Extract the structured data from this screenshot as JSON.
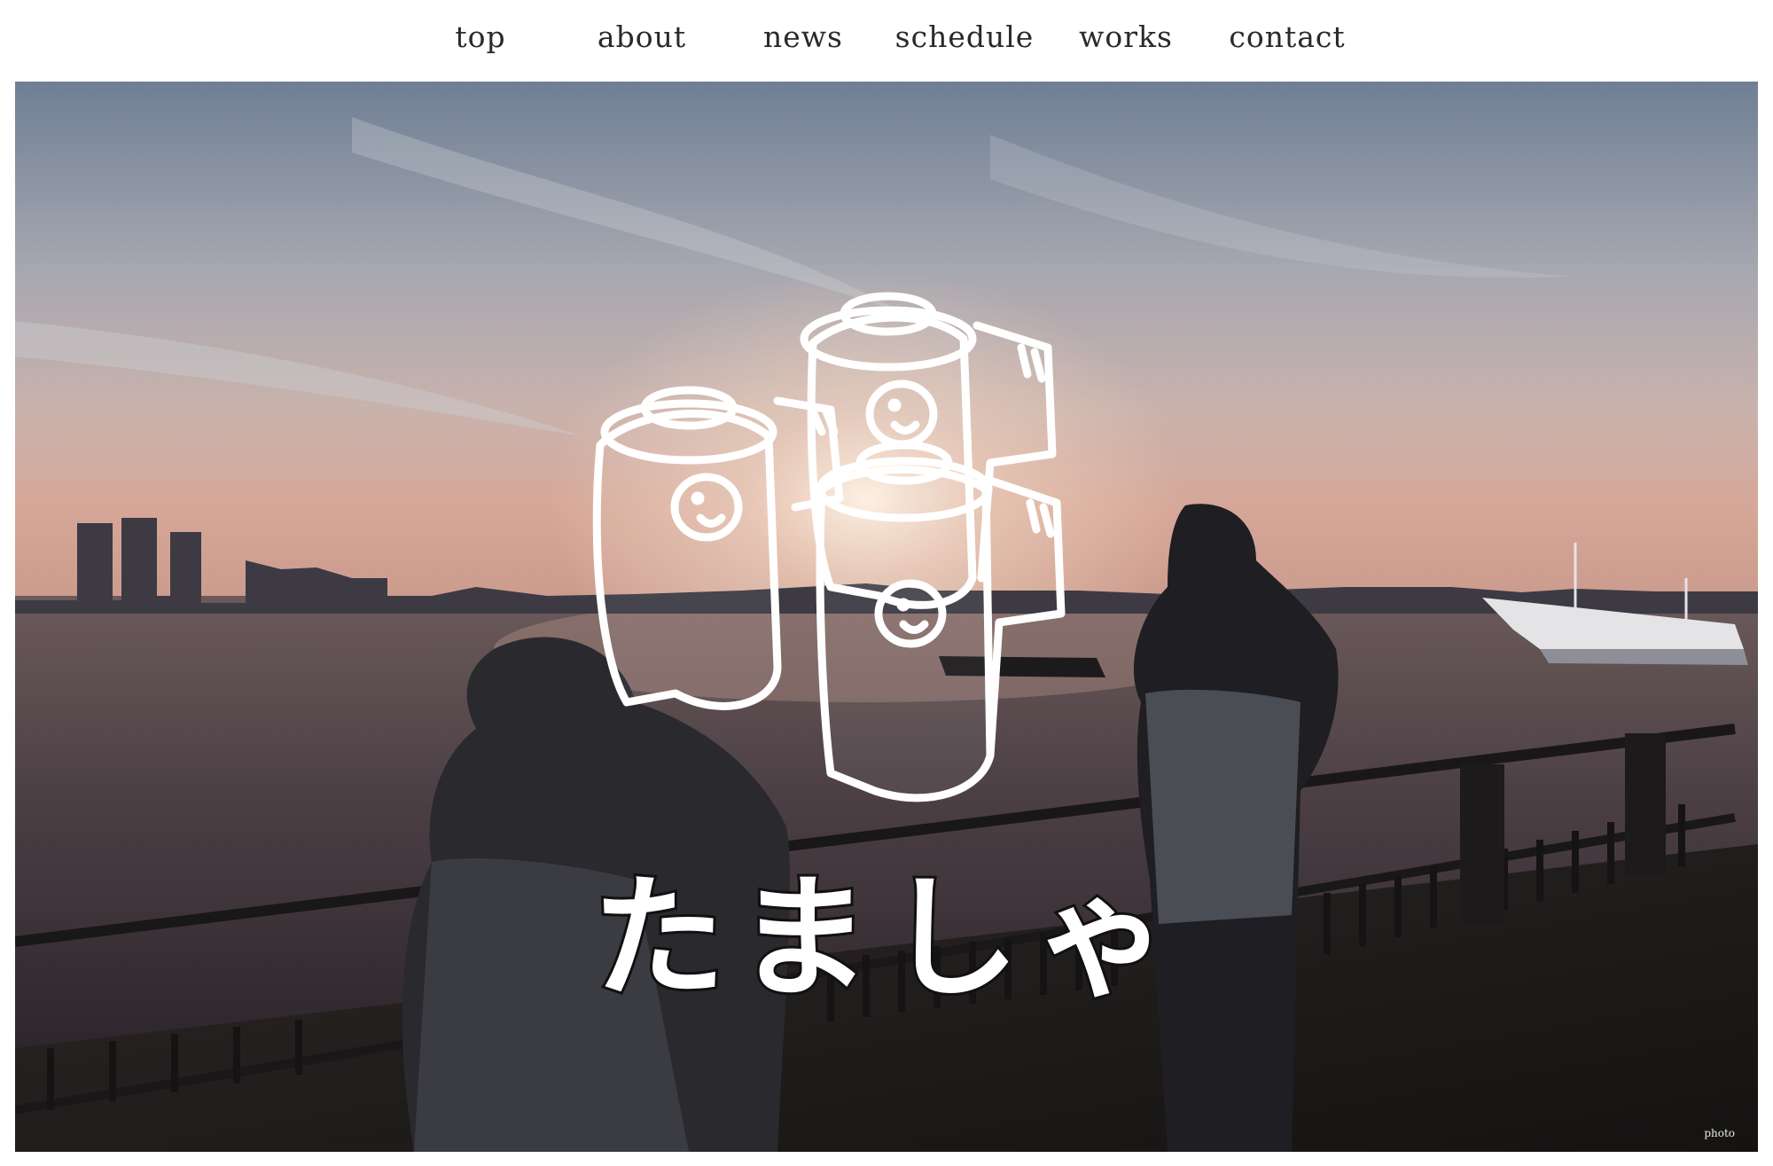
{
  "nav": {
    "items": [
      {
        "label": "top"
      },
      {
        "label": "about"
      },
      {
        "label": "news"
      },
      {
        "label": "schedule"
      },
      {
        "label": "works"
      },
      {
        "label": "contact"
      }
    ]
  },
  "hero": {
    "logo_text": "たましゃ",
    "photo_credit": "photo"
  }
}
